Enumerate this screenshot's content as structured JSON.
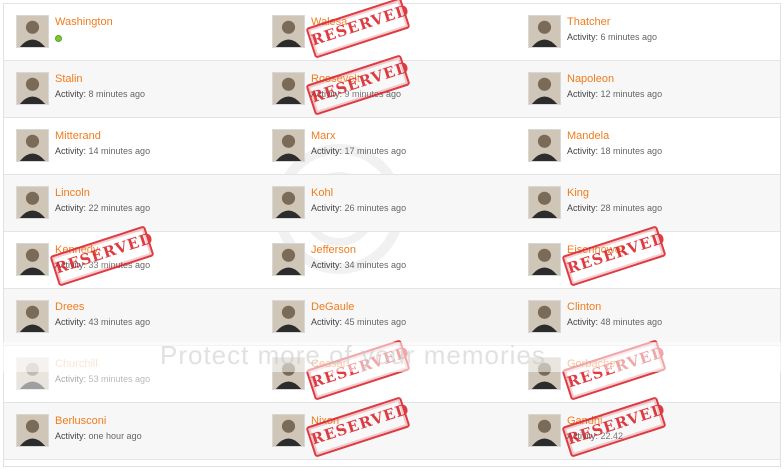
{
  "colors": {
    "name": "#ee7d1e",
    "stamp": "#d9222a",
    "online": "#7ec63a"
  },
  "activity_label": "Activity:",
  "watermark": {
    "text": "Protect more of your memories"
  },
  "rows": [
    [
      {
        "name": "Washington",
        "activity": "",
        "online": true,
        "reserved": false
      },
      {
        "name": "Walesa",
        "activity": "",
        "reserved": true
      },
      {
        "name": "Thatcher",
        "activity": "6 minutes ago",
        "reserved": false
      }
    ],
    [
      {
        "name": "Stalin",
        "activity": "8 minutes ago",
        "reserved": false
      },
      {
        "name": "Roosevelt",
        "activity": "9 minutes ago",
        "reserved": true
      },
      {
        "name": "Napoleon",
        "activity": "12 minutes ago",
        "reserved": false
      }
    ],
    [
      {
        "name": "Mitterand",
        "activity": "14 minutes ago",
        "reserved": false
      },
      {
        "name": "Marx",
        "activity": "17 minutes ago",
        "reserved": false
      },
      {
        "name": "Mandela",
        "activity": "18 minutes ago",
        "reserved": false
      }
    ],
    [
      {
        "name": "Lincoln",
        "activity": "22 minutes ago",
        "reserved": false
      },
      {
        "name": "Kohl",
        "activity": "26 minutes ago",
        "reserved": false
      },
      {
        "name": "King",
        "activity": "28 minutes ago",
        "reserved": false
      }
    ],
    [
      {
        "name": "Kennedy",
        "activity": "33 minutes ago",
        "reserved": true
      },
      {
        "name": "Jefferson",
        "activity": "34 minutes ago",
        "reserved": false
      },
      {
        "name": "Eisenhower",
        "activity": "",
        "reserved": true
      }
    ],
    [
      {
        "name": "Drees",
        "activity": "43 minutes ago",
        "reserved": false
      },
      {
        "name": "DeGaule",
        "activity": "45 minutes ago",
        "reserved": false
      },
      {
        "name": "Clinton",
        "activity": "48 minutes ago",
        "reserved": false
      }
    ],
    [
      {
        "name": "Churchill",
        "activity": "53 minutes ago",
        "reserved": false
      },
      {
        "name": "Ceasar",
        "activity": "",
        "reserved": true
      },
      {
        "name": "Gorbachev",
        "activity": "",
        "reserved": true
      }
    ],
    [
      {
        "name": "Berlusconi",
        "activity": "one hour ago",
        "reserved": false
      },
      {
        "name": "Nixon",
        "activity": "",
        "reserved": true
      },
      {
        "name": "Gandhi",
        "activity": "22.42",
        "reserved": true
      }
    ]
  ],
  "stamp_label": "RESERVED"
}
